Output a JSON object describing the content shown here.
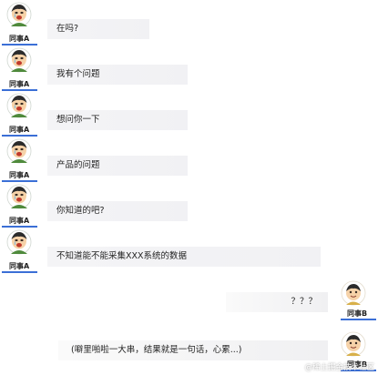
{
  "left_messages": [
    {
      "name": "同事A",
      "text": "在吗?"
    },
    {
      "name": "同事A",
      "text": "我有个问题"
    },
    {
      "name": "同事A",
      "text": "想问你一下"
    },
    {
      "name": "同事A",
      "text": "产品的问题"
    },
    {
      "name": "同事A",
      "text": "你知道的吧?"
    },
    {
      "name": "同事A",
      "text": "不知道能不能采集XXX系统的数据"
    }
  ],
  "right_messages": [
    {
      "name": "同事B",
      "text": "？？？"
    },
    {
      "name": "同事B",
      "text": "(噼里啪啦一大串，结果就是一句话，心累...)"
    }
  ],
  "watermark": "@稀土掘金技术社区",
  "colors": {
    "underline": "#3b6fd6",
    "avatar_shirt": "#4f8a3c",
    "avatar_hair": "#2b2b2b"
  },
  "icons": {
    "avatar_a": "cartoon-crying-face",
    "avatar_b": "cartoon-smiling-face"
  }
}
